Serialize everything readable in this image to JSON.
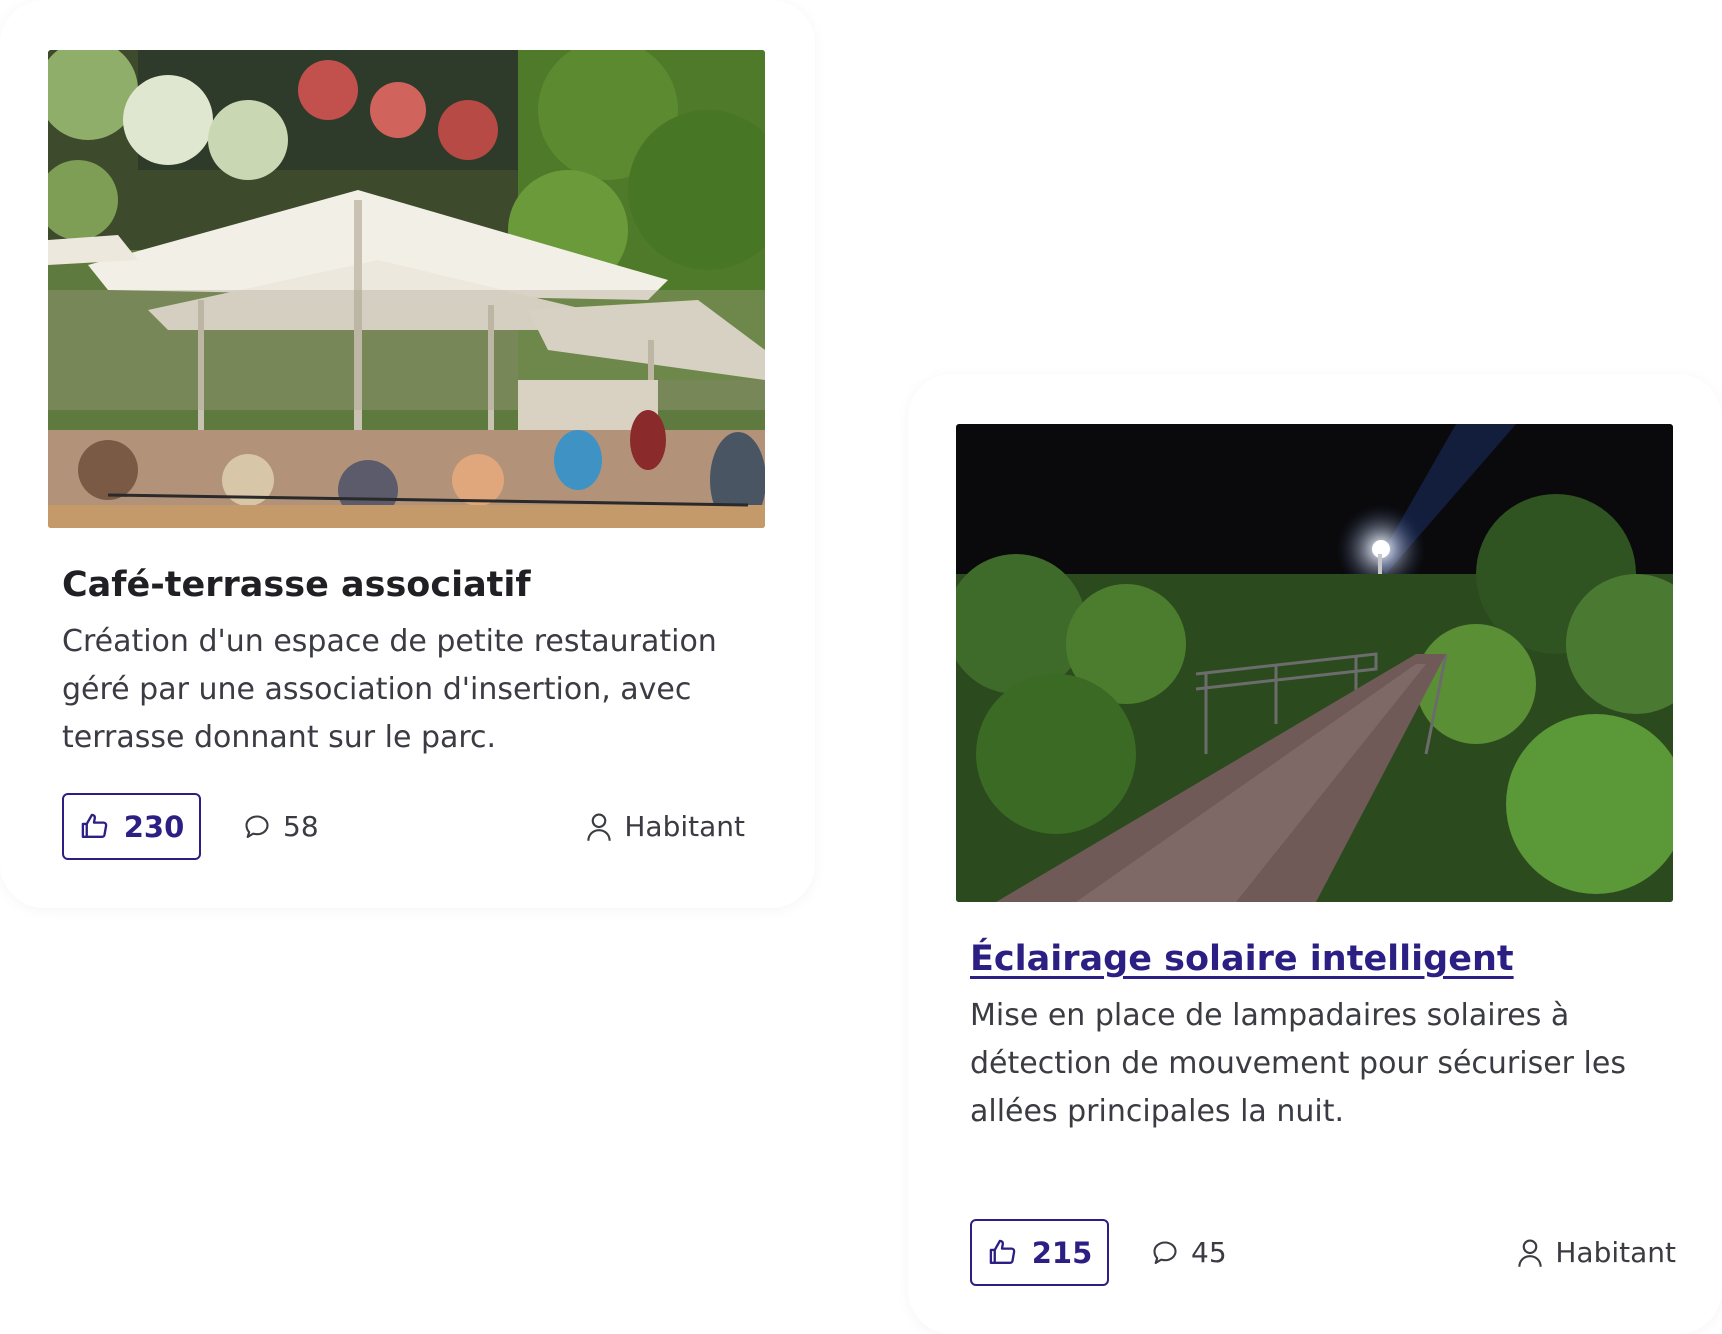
{
  "cards": [
    {
      "title": "Café-terrasse associatif",
      "description": "Création d'un espace de petite restauration géré par une association d'insertion, avec terrasse donnant sur le parc.",
      "votes": "230",
      "comments": "58",
      "author": "Habitant",
      "image_icon": "cafe-terrace-photo"
    },
    {
      "title": "Éclairage solaire intelligent",
      "description": "Mise en place de lampadaires solaires à détection de mouvement pour sécuriser les allées principales la nuit.",
      "votes": "215",
      "comments": "45",
      "author": "Habitant",
      "image_icon": "night-path-photo"
    }
  ],
  "icons": {
    "vote": "thumbs-up-icon",
    "comment": "speech-bubble-icon",
    "author": "user-icon"
  },
  "colors": {
    "accent": "#2c1f83",
    "text": "#1f1f24",
    "muted": "#3b3b43"
  }
}
